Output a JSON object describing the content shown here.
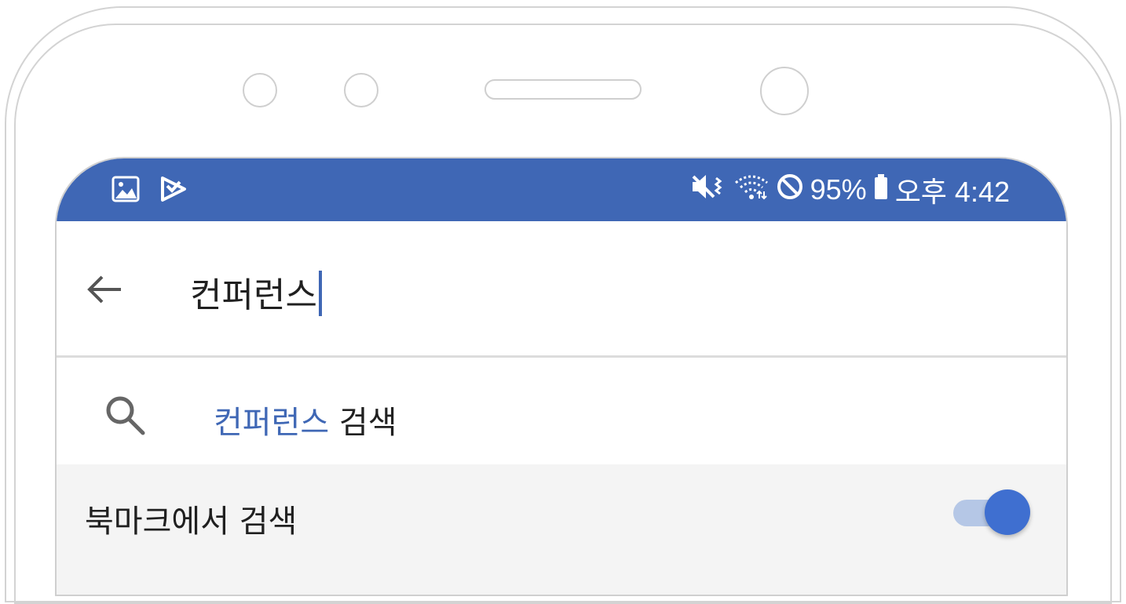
{
  "status_bar": {
    "icons_left": [
      "gallery-icon",
      "play-store-icon"
    ],
    "icons_right": [
      "mute-vibrate-icon",
      "wifi-icon",
      "do-not-disturb-icon",
      "battery-icon"
    ],
    "battery_percent": "95%",
    "time": "오후 4:42",
    "background_color": "#3f67b5"
  },
  "search_bar": {
    "back_icon": "arrow-left-icon",
    "query": "컨퍼런스"
  },
  "suggestion": {
    "icon": "search-icon",
    "query": "컨퍼런스",
    "suffix": " 검색",
    "highlight_color": "#3f67b5"
  },
  "bookmark_search": {
    "label": "북마크에서 검색",
    "toggle_on": true
  }
}
